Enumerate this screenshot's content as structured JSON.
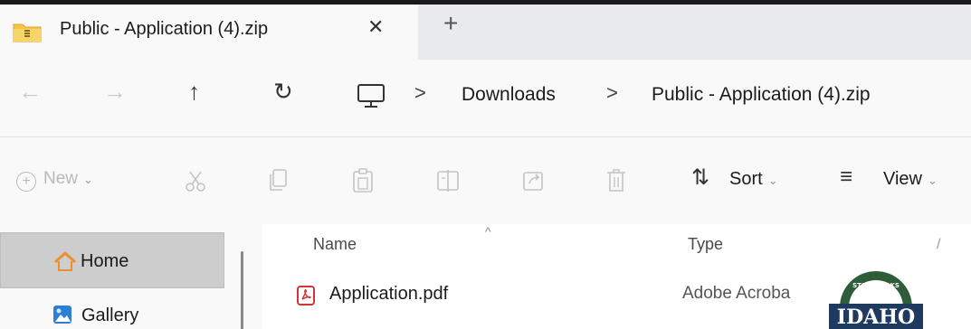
{
  "window": {
    "tab_title": "Public - Application (4).zip",
    "tab_close": "✕",
    "new_tab": "+"
  },
  "address_bar": {
    "back": "←",
    "forward": "→",
    "up": "↑",
    "refresh": "↻",
    "separator": ">",
    "breadcrumbs": [
      "Downloads",
      "Public - Application (4).zip"
    ]
  },
  "command_bar": {
    "new_label": "New",
    "sort_label": "Sort",
    "view_label": "View",
    "sort_glyph": "⇅",
    "view_glyph": "≡",
    "chevron": "⌄"
  },
  "nav_pane": {
    "items": [
      {
        "label": "Home",
        "icon": "home-icon",
        "selected": true
      },
      {
        "label": "Gallery",
        "icon": "gallery-icon",
        "selected": false
      }
    ]
  },
  "file_list": {
    "columns": [
      "Name",
      "Type"
    ],
    "sort_indicator": "^",
    "rows": [
      {
        "name": "Application.pdf",
        "type": "Adobe Acroba",
        "icon": "pdf-icon"
      }
    ]
  },
  "logo": {
    "text": "IDAHO",
    "ring_text": "STATE PARKS"
  },
  "colors": {
    "accent": "#0067c0",
    "pdf_red": "#d13438",
    "folder_yellow": "#f4c542",
    "logo_green": "#2f5d3a",
    "logo_navy": "#1f3a5f"
  }
}
